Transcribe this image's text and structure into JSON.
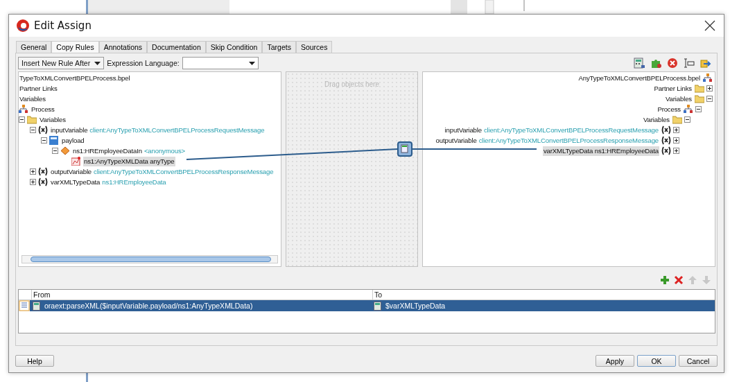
{
  "window": {
    "title": "Edit Assign"
  },
  "tabs": [
    {
      "label": "General",
      "selected": false
    },
    {
      "label": "Copy Rules",
      "selected": true
    },
    {
      "label": "Annotations",
      "selected": false
    },
    {
      "label": "Documentation",
      "selected": false
    },
    {
      "label": "Skip Condition",
      "selected": false
    },
    {
      "label": "Targets",
      "selected": false
    },
    {
      "label": "Sources",
      "selected": false
    }
  ],
  "toolbar": {
    "insert_mode": "Insert New Rule After",
    "expression_language_label": "Expression Language:"
  },
  "left_tree": [
    {
      "kind": "none",
      "name": "TypeToXMLConvertBPELProcess.bpel",
      "selected": false
    },
    {
      "kind": "none",
      "name": "Partner Links",
      "selected": false
    },
    {
      "kind": "none",
      "name": "Variables",
      "selected": false
    },
    {
      "kind": "process",
      "name": "Process",
      "selected": false,
      "children": [
        {
          "kind": "folder",
          "name": "Variables",
          "expanded": true,
          "selected": false,
          "children": [
            {
              "kind": "variable",
              "name": "inputVariable",
              "type": "client:AnyTypeToXMLConvertBPELProcessRequestMessage",
              "expanded": true,
              "selected": false,
              "children": [
                {
                  "kind": "part",
                  "name": "payload",
                  "expanded": true,
                  "selected": false,
                  "children": [
                    {
                      "kind": "element",
                      "name": "ns1:HREmployeeDataIn",
                      "type": "<anonymous>",
                      "expanded": true,
                      "selected": false,
                      "children": [
                        {
                          "kind": "attribute",
                          "name": "ns1:AnyTypeXMLData anyType",
                          "selected": true
                        }
                      ]
                    }
                  ]
                }
              ]
            },
            {
              "kind": "variable",
              "name": "outputVariable",
              "type": "client:AnyTypeToXMLConvertBPELProcessResponseMessage",
              "expanded": false,
              "selected": false
            },
            {
              "kind": "variable",
              "name": "varXMLTypeData",
              "type": "ns1:HREmployeeData",
              "expanded": false,
              "selected": false
            }
          ]
        }
      ]
    }
  ],
  "canvas": {
    "placeholder": "Drag objects here"
  },
  "right_tree": [
    {
      "kind": "process",
      "name": "AnyTypeToXMLConvertBPELProcess.bpel",
      "selected": false,
      "children": [
        {
          "kind": "folder",
          "name": "Partner Links",
          "expanded": false,
          "selected": false
        },
        {
          "kind": "folder",
          "name": "Variables",
          "expanded": true,
          "selected": false,
          "children": [
            {
              "kind": "process",
              "name": "Process",
              "expanded": true,
              "selected": false,
              "children": [
                {
                  "kind": "folder",
                  "name": "Variables",
                  "expanded": true,
                  "selected": false,
                  "children": [
                    {
                      "kind": "variable",
                      "name": "inputVariable",
                      "type": "client:AnyTypeToXMLConvertBPELProcessRequestMessage",
                      "expanded": false,
                      "selected": false
                    },
                    {
                      "kind": "variable",
                      "name": "outputVariable",
                      "type": "client:AnyTypeToXMLConvertBPELProcessResponseMessage",
                      "expanded": false,
                      "selected": false
                    },
                    {
                      "kind": "variable",
                      "name": "varXMLTypeData ns1:HREmployeeData",
                      "expanded": false,
                      "selected": true
                    }
                  ]
                }
              ]
            }
          ]
        }
      ]
    }
  ],
  "rules_table": {
    "columns": [
      "From",
      "To"
    ],
    "rows": [
      {
        "from": "oraext:parseXML($inputVariable.payload/ns1:AnyTypeXMLData)",
        "to": "$varXMLTypeData",
        "selected": true
      }
    ]
  },
  "buttons": {
    "help": "Help",
    "apply": "Apply",
    "ok": "OK",
    "cancel": "Cancel"
  }
}
